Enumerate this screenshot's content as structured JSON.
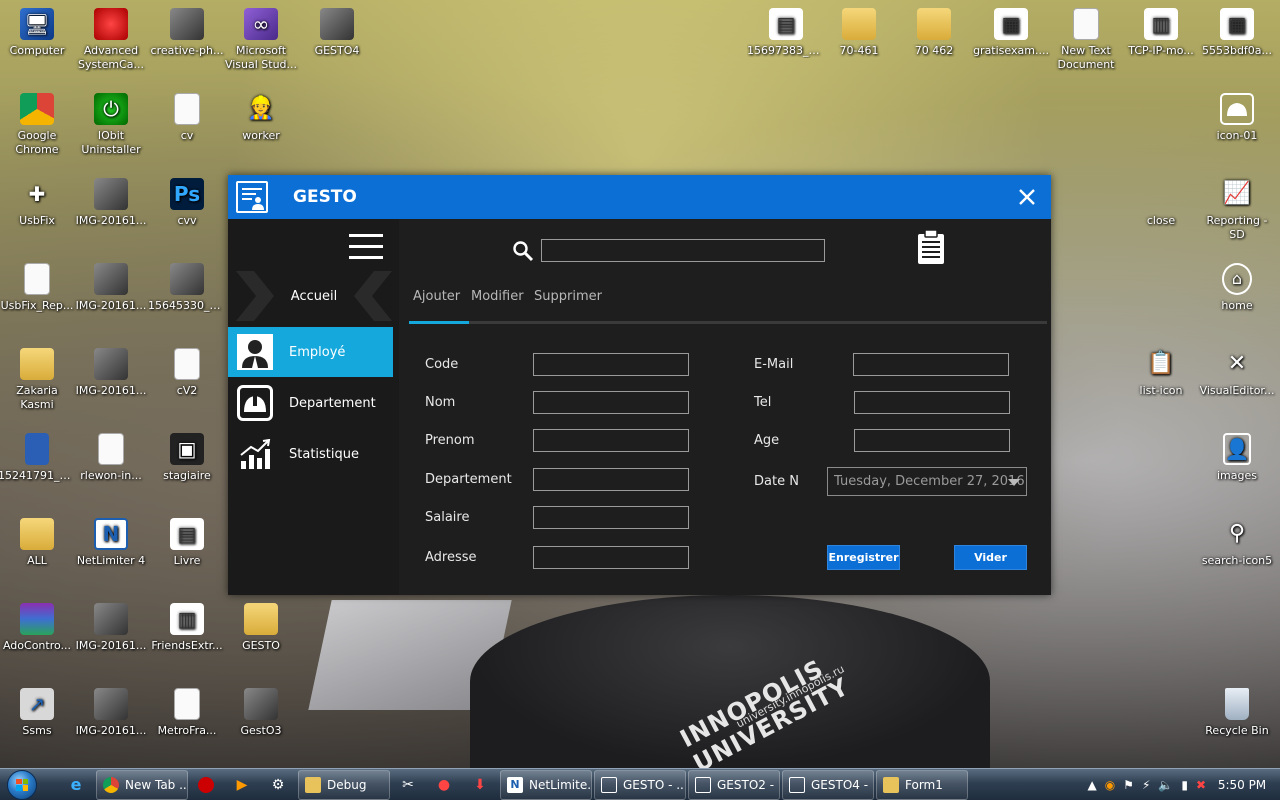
{
  "desktop": {
    "icons": [
      {
        "label": "Computer",
        "icon": "computer-icon"
      },
      {
        "label": "Advanced SystemCa...",
        "icon": "advanced-systemcare-icon"
      },
      {
        "label": "creative-ph...",
        "icon": "image-icon"
      },
      {
        "label": "Microsoft Visual Stud...",
        "icon": "visual-studio-icon"
      },
      {
        "label": "GESTO4",
        "icon": "image-icon"
      },
      {
        "label": "15697383_2...",
        "icon": "image-icon"
      },
      {
        "label": "70-461",
        "icon": "folder-icon"
      },
      {
        "label": "70 462",
        "icon": "folder-icon"
      },
      {
        "label": "gratisexam....",
        "icon": "document-icon"
      },
      {
        "label": "New Text Document",
        "icon": "text-document-icon"
      },
      {
        "label": "TCP-IP-mo...",
        "icon": "image-icon"
      },
      {
        "label": "5553bdf0a...",
        "icon": "image-icon"
      },
      {
        "label": "Google Chrome",
        "icon": "chrome-icon"
      },
      {
        "label": "IObit Uninstaller",
        "icon": "iobit-icon"
      },
      {
        "label": "cv",
        "icon": "document-icon"
      },
      {
        "label": "worker",
        "icon": "worker-icon"
      },
      {
        "label": "icon-01",
        "icon": "helmet-icon"
      },
      {
        "label": "UsbFix",
        "icon": "usbfix-icon"
      },
      {
        "label": "IMG-20161...",
        "icon": "image-icon"
      },
      {
        "label": "cvv",
        "icon": "photoshop-icon"
      },
      {
        "label": "close",
        "icon": "close-icon"
      },
      {
        "label": "Reporting - SD",
        "icon": "chart-icon"
      },
      {
        "label": "UsbFix_Rep...",
        "icon": "text-document-icon"
      },
      {
        "label": "IMG-20161...",
        "icon": "image-icon"
      },
      {
        "label": "15645330_1...",
        "icon": "image-icon"
      },
      {
        "label": "home",
        "icon": "home-icon"
      },
      {
        "label": "Zakaria Kasmi",
        "icon": "folder-icon"
      },
      {
        "label": "IMG-20161...",
        "icon": "image-icon"
      },
      {
        "label": "cV2",
        "icon": "document-icon"
      },
      {
        "label": "list-icon",
        "icon": "clipboard-icon"
      },
      {
        "label": "VisualEditor...",
        "icon": "close-icon"
      },
      {
        "label": "15241791_1...",
        "icon": "image-icon"
      },
      {
        "label": "rlewon-in...",
        "icon": "text-document-icon"
      },
      {
        "label": "stagiaire",
        "icon": "image-icon"
      },
      {
        "label": "images",
        "icon": "id-card-icon"
      },
      {
        "label": "ALL",
        "icon": "folder-icon"
      },
      {
        "label": "NetLimiter 4",
        "icon": "netlimiter-icon"
      },
      {
        "label": "Livre",
        "icon": "document-icon"
      },
      {
        "label": "search-icon5",
        "icon": "search-icon"
      },
      {
        "label": "AdoContro...",
        "icon": "winrar-icon"
      },
      {
        "label": "IMG-20161...",
        "icon": "image-icon"
      },
      {
        "label": "FriendsExtr...",
        "icon": "image-icon"
      },
      {
        "label": "GESTO",
        "icon": "folder-icon"
      },
      {
        "label": "Ssms",
        "icon": "shortcut-icon"
      },
      {
        "label": "IMG-20161...",
        "icon": "image-icon"
      },
      {
        "label": "MetroFra...",
        "icon": "document-icon"
      },
      {
        "label": "GestO3",
        "icon": "image-icon"
      },
      {
        "label": "Recycle Bin",
        "icon": "recycle-bin-icon"
      }
    ],
    "wallpaper_text": {
      "brand": "INNOPOLIS UNIVERSITY",
      "url": "university.innopolis.ru"
    }
  },
  "app": {
    "title": "GESTO",
    "accent_color": "#0b6fd6",
    "active_color": "#14a8dc",
    "sidebar": {
      "home_label": "Accueil",
      "items": [
        {
          "label": "Employé",
          "icon": "employee-icon",
          "active": true
        },
        {
          "label": "Departement",
          "icon": "helmet-icon",
          "active": false
        },
        {
          "label": "Statistique",
          "icon": "chart-icon",
          "active": false
        }
      ]
    },
    "search": {
      "value": "",
      "placeholder": ""
    },
    "tabs": [
      "Ajouter",
      "Modifier",
      "Supprimer"
    ],
    "active_tab": "Ajouter",
    "form": {
      "left": [
        {
          "label": "Code",
          "value": ""
        },
        {
          "label": "Nom",
          "value": ""
        },
        {
          "label": "Prenom",
          "value": ""
        },
        {
          "label": "Departement",
          "value": ""
        },
        {
          "label": "Salaire",
          "value": ""
        },
        {
          "label": "Adresse",
          "value": ""
        }
      ],
      "right": [
        {
          "label": "E-Mail",
          "value": ""
        },
        {
          "label": "Tel",
          "value": ""
        },
        {
          "label": "Age",
          "value": ""
        }
      ],
      "date_label": "Date N",
      "date_value": "Tuesday, December 27, 2016",
      "save_label": "Enregistrer",
      "clear_label": "Vider"
    }
  },
  "taskbar": {
    "tasks": [
      {
        "label": "New Tab ...",
        "icon": "chrome-icon"
      },
      {
        "label": "Debug",
        "icon": "folder-icon"
      },
      {
        "label": "NetLimite...",
        "icon": "netlimiter-icon"
      },
      {
        "label": "GESTO - ...",
        "icon": "window-icon"
      },
      {
        "label": "GESTO2 - ...",
        "icon": "window-icon"
      },
      {
        "label": "GESTO4 - ...",
        "icon": "window-icon"
      },
      {
        "label": "Form1",
        "icon": "form-icon"
      }
    ],
    "clock": "5:50 PM"
  }
}
